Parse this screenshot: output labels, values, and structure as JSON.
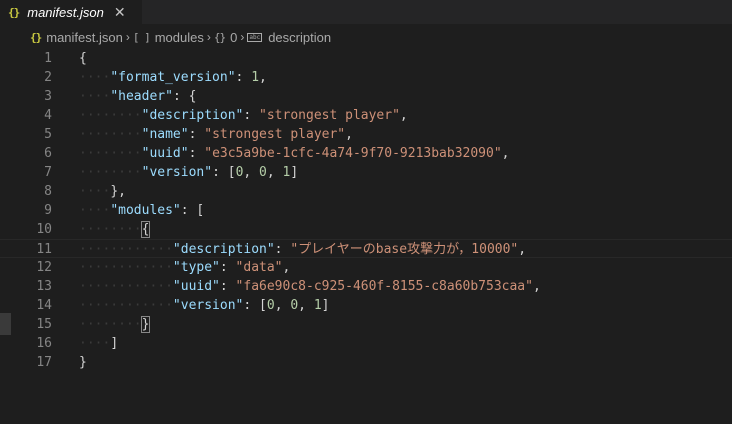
{
  "tab": {
    "icon": "{}",
    "label": "manifest.json",
    "close": "✕"
  },
  "breadcrumb": {
    "items": [
      {
        "icon": "{}",
        "label": "manifest.json"
      },
      {
        "icon": "[ ]",
        "label": "modules"
      },
      {
        "icon": "{}",
        "label": "0"
      },
      {
        "icon": "abc",
        "label": "description"
      }
    ],
    "separator": "›"
  },
  "lines": [
    {
      "n": "1",
      "indent": "",
      "tokens": [
        {
          "t": "{",
          "c": "p"
        }
      ]
    },
    {
      "n": "2",
      "indent": "····",
      "tokens": [
        {
          "t": "\"format_version\"",
          "c": "k"
        },
        {
          "t": ": ",
          "c": "p"
        },
        {
          "t": "1",
          "c": "n"
        },
        {
          "t": ",",
          "c": "p"
        }
      ]
    },
    {
      "n": "3",
      "indent": "····",
      "tokens": [
        {
          "t": "\"header\"",
          "c": "k"
        },
        {
          "t": ": {",
          "c": "p"
        }
      ]
    },
    {
      "n": "4",
      "indent": "········",
      "tokens": [
        {
          "t": "\"description\"",
          "c": "k"
        },
        {
          "t": ": ",
          "c": "p"
        },
        {
          "t": "\"strongest player\"",
          "c": "s"
        },
        {
          "t": ",",
          "c": "p"
        }
      ]
    },
    {
      "n": "5",
      "indent": "········",
      "tokens": [
        {
          "t": "\"name\"",
          "c": "k"
        },
        {
          "t": ": ",
          "c": "p"
        },
        {
          "t": "\"strongest player\"",
          "c": "s"
        },
        {
          "t": ",",
          "c": "p"
        }
      ]
    },
    {
      "n": "6",
      "indent": "········",
      "tokens": [
        {
          "t": "\"uuid\"",
          "c": "k"
        },
        {
          "t": ": ",
          "c": "p"
        },
        {
          "t": "\"e3c5a9be-1cfc-4a74-9f70-9213bab32090\"",
          "c": "s"
        },
        {
          "t": ",",
          "c": "p"
        }
      ]
    },
    {
      "n": "7",
      "indent": "········",
      "tokens": [
        {
          "t": "\"version\"",
          "c": "k"
        },
        {
          "t": ": [",
          "c": "p"
        },
        {
          "t": "0",
          "c": "n"
        },
        {
          "t": ", ",
          "c": "p"
        },
        {
          "t": "0",
          "c": "n"
        },
        {
          "t": ", ",
          "c": "p"
        },
        {
          "t": "1",
          "c": "n"
        },
        {
          "t": "]",
          "c": "p"
        }
      ]
    },
    {
      "n": "8",
      "indent": "····",
      "tokens": [
        {
          "t": "},",
          "c": "p"
        }
      ]
    },
    {
      "n": "9",
      "indent": "····",
      "tokens": [
        {
          "t": "\"modules\"",
          "c": "k"
        },
        {
          "t": ": [",
          "c": "p"
        }
      ]
    },
    {
      "n": "10",
      "indent": "········",
      "tokens": [
        {
          "t": "{",
          "c": "p",
          "bm": true
        }
      ]
    },
    {
      "n": "11",
      "indent": "············",
      "tokens": [
        {
          "t": "\"description\"",
          "c": "k"
        },
        {
          "t": ": ",
          "c": "p"
        },
        {
          "t": "\"プレイヤーのbase攻撃力が，10000\"",
          "c": "s"
        },
        {
          "t": ",",
          "c": "p"
        }
      ],
      "current": true
    },
    {
      "n": "12",
      "indent": "············",
      "tokens": [
        {
          "t": "\"type\"",
          "c": "k"
        },
        {
          "t": ": ",
          "c": "p"
        },
        {
          "t": "\"data\"",
          "c": "s"
        },
        {
          "t": ",",
          "c": "p"
        }
      ]
    },
    {
      "n": "13",
      "indent": "············",
      "tokens": [
        {
          "t": "\"uuid\"",
          "c": "k"
        },
        {
          "t": ": ",
          "c": "p"
        },
        {
          "t": "\"fa6e90c8-c925-460f-8155-c8a60b753caa\"",
          "c": "s"
        },
        {
          "t": ",",
          "c": "p"
        }
      ]
    },
    {
      "n": "14",
      "indent": "············",
      "tokens": [
        {
          "t": "\"version\"",
          "c": "k"
        },
        {
          "t": ": [",
          "c": "p"
        },
        {
          "t": "0",
          "c": "n"
        },
        {
          "t": ", ",
          "c": "p"
        },
        {
          "t": "0",
          "c": "n"
        },
        {
          "t": ", ",
          "c": "p"
        },
        {
          "t": "1",
          "c": "n"
        },
        {
          "t": "]",
          "c": "p"
        }
      ]
    },
    {
      "n": "15",
      "indent": "········",
      "tokens": [
        {
          "t": "}",
          "c": "p",
          "bm": true
        }
      ]
    },
    {
      "n": "16",
      "indent": "····",
      "tokens": [
        {
          "t": "]",
          "c": "p"
        }
      ]
    },
    {
      "n": "17",
      "indent": "",
      "tokens": [
        {
          "t": "}",
          "c": "p"
        }
      ]
    }
  ]
}
